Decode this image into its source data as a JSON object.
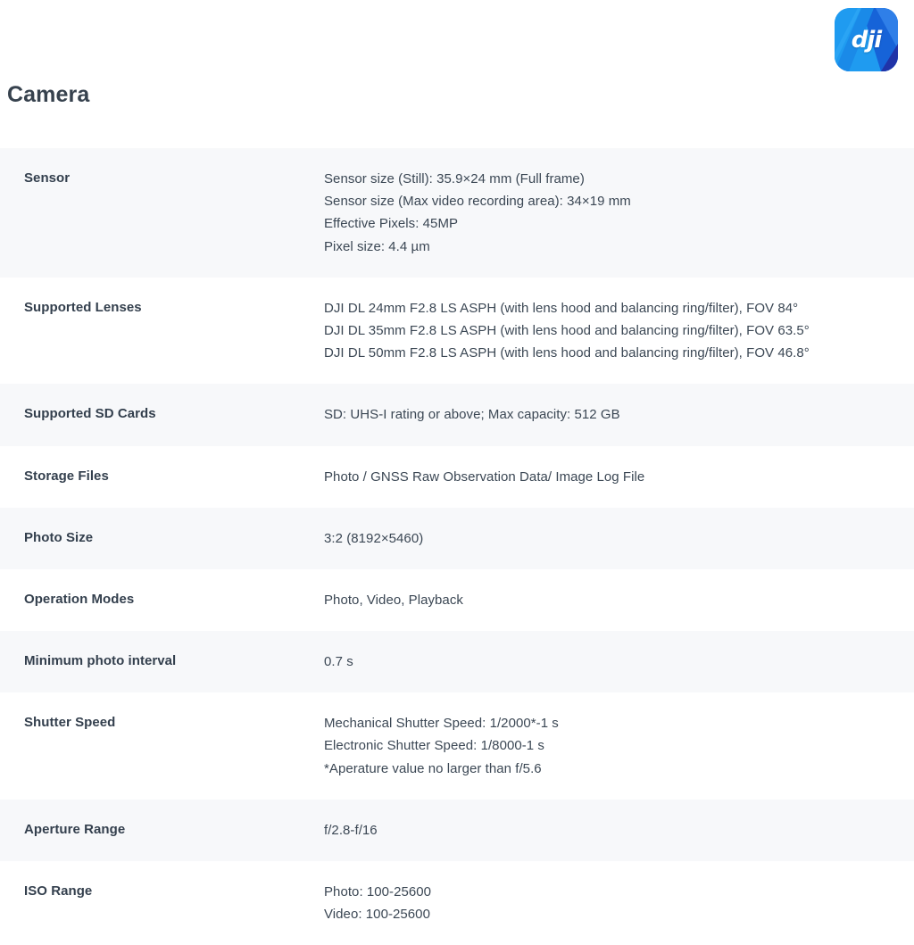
{
  "brand": {
    "logo_icon": "dji-app-logo",
    "logo_text": "dji",
    "colors": {
      "logo_light_blue": "#1f9bf0",
      "logo_mid_blue": "#1663d8",
      "logo_dark_blue": "#2033a8",
      "text_dark": "#333f4d",
      "row_shade": "#f7f8fa",
      "page_background": "#ffffff"
    }
  },
  "page": {
    "title": "Camera"
  },
  "spec_table": {
    "rows": [
      {
        "label": "Sensor",
        "values": [
          "Sensor size (Still): 35.9×24 mm (Full frame)",
          "Sensor size (Max video recording area): 34×19 mm",
          "Effective Pixels: 45MP",
          "Pixel size: 4.4 µm"
        ]
      },
      {
        "label": "Supported Lenses",
        "values": [
          "DJI DL 24mm F2.8 LS ASPH (with lens hood and balancing ring/filter), FOV 84°",
          "DJI DL 35mm F2.8 LS ASPH (with lens hood and balancing ring/filter), FOV 63.5°",
          "DJI DL 50mm F2.8 LS ASPH (with lens hood and balancing ring/filter), FOV 46.8°"
        ]
      },
      {
        "label": "Supported SD Cards",
        "values": [
          "SD: UHS-I rating or above; Max capacity: 512 GB"
        ]
      },
      {
        "label": "Storage Files",
        "values": [
          "Photo / GNSS Raw Observation Data/ Image Log File"
        ]
      },
      {
        "label": "Photo Size",
        "values": [
          "3:2 (8192×5460)"
        ]
      },
      {
        "label": "Operation Modes",
        "values": [
          "Photo, Video, Playback"
        ]
      },
      {
        "label": "Minimum photo interval",
        "values": [
          "0.7 s"
        ]
      },
      {
        "label": "Shutter Speed",
        "values": [
          "Mechanical Shutter Speed: 1/2000*-1 s",
          "Electronic Shutter Speed: 1/8000-1 s",
          "*Aperature value no larger than f/5.6"
        ]
      },
      {
        "label": "Aperture Range",
        "values": [
          "f/2.8-f/16"
        ]
      },
      {
        "label": "ISO Range",
        "values": [
          "Photo: 100-25600",
          "Video: 100-25600"
        ]
      }
    ]
  }
}
